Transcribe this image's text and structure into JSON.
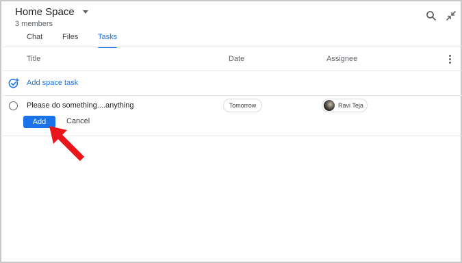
{
  "header": {
    "title": "Home Space",
    "members": "3 members"
  },
  "tabs": [
    {
      "label": "Chat",
      "active": false
    },
    {
      "label": "Files",
      "active": false
    },
    {
      "label": "Tasks",
      "active": true
    }
  ],
  "table": {
    "columns": [
      "Title",
      "Date",
      "Assignee"
    ]
  },
  "add_task": {
    "label": "Add space task"
  },
  "task": {
    "text": "Please do something....anything",
    "date": "Tomorrow",
    "assignee": "Ravi Teja"
  },
  "actions": {
    "add_label": "Add",
    "cancel_label": "Cancel"
  },
  "colors": {
    "accent": "#1a73e8",
    "annotation_arrow": "#e8161b"
  },
  "icons": [
    "search-icon",
    "collapse-icon",
    "more-vert-icon",
    "add-task-icon",
    "chevron-down-icon"
  ]
}
